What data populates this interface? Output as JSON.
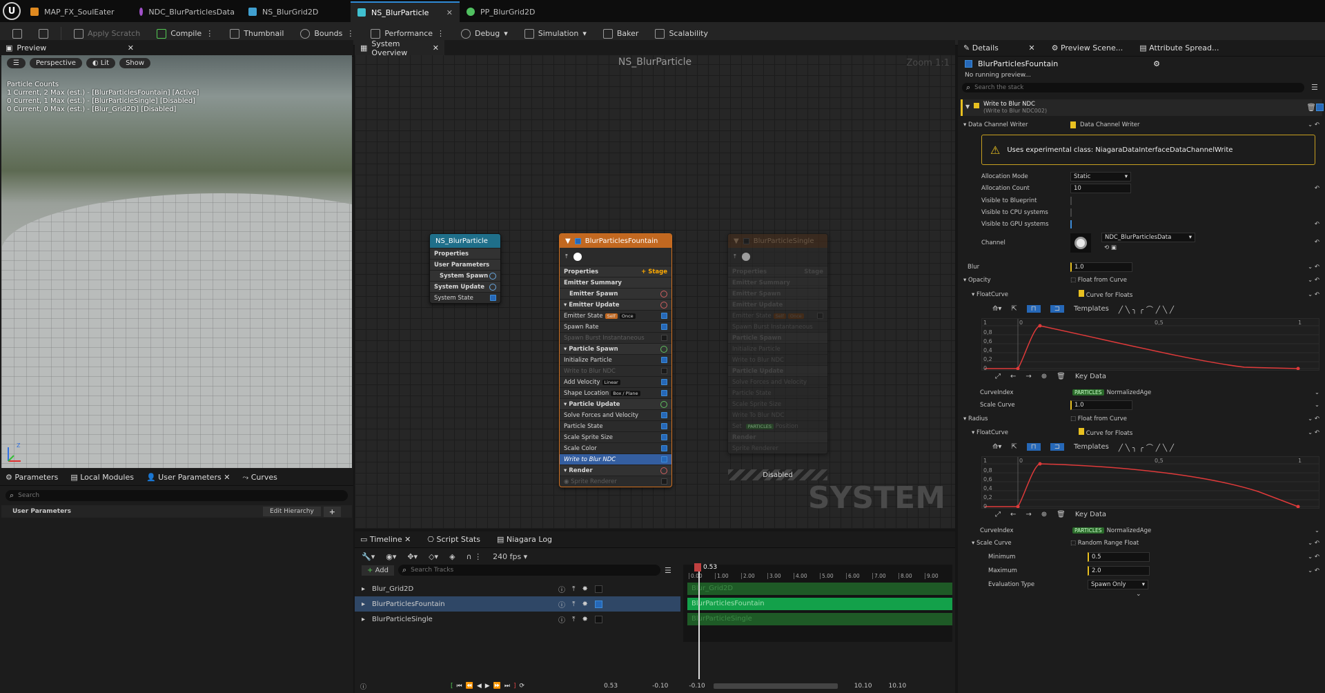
{
  "tabs": [
    {
      "label": "MAP_FX_SoulEater",
      "color": "#e08a20"
    },
    {
      "label": "NDC_BlurParticlesData",
      "color": "#a050c8"
    },
    {
      "label": "NS_BlurGrid2D",
      "color": "#40a0d0"
    },
    {
      "label": "NS_BlurParticle",
      "color": "#40c0d0",
      "active": true
    },
    {
      "label": "PP_BlurGrid2D",
      "color": "#50c060"
    }
  ],
  "toolbar": {
    "apply_scratch": "Apply Scratch",
    "compile": "Compile",
    "thumbnail": "Thumbnail",
    "bounds": "Bounds",
    "performance": "Performance",
    "debug": "Debug",
    "simulation": "Simulation",
    "baker": "Baker",
    "scalability": "Scalability"
  },
  "preview": {
    "tab": "Preview",
    "perspective": "Perspective",
    "lit": "Lit",
    "show": "Show",
    "stats_title": "Particle Counts",
    "stats": [
      "1 Current, 2 Max (est.) - [BlurParticlesFountain] [Active]",
      "0 Current, 1 Max (est.) - [BlurParticleSingle] [Disabled]",
      "0 Current, 0 Max (est.) - [Blur_Grid2D] [Disabled]"
    ]
  },
  "params": {
    "tabs": [
      "Parameters",
      "Local Modules",
      "User Parameters",
      "Curves"
    ],
    "search_placeholder": "Search",
    "section": "User Parameters",
    "edit_hierarchy": "Edit Hierarchy"
  },
  "graph": {
    "tab": "System Overview",
    "title": "NS_BlurParticle",
    "zoom": "Zoom 1:1",
    "watermark": "SYSTEM",
    "system_node": {
      "title": "NS_BlurParticle",
      "rows": [
        "Properties",
        "User Parameters",
        "System Spawn",
        "System Update",
        "System State"
      ]
    },
    "fountain": {
      "title": "BlurParticlesFountain",
      "properties": "Properties",
      "stage": "Stage",
      "emitter_summary": "Emitter Summary",
      "emitter_spawn": "Emitter Spawn",
      "emitter_update": "Emitter Update",
      "emitter_state": "Emitter State",
      "self": "Self",
      "once": "Once",
      "spawn_rate": "Spawn Rate",
      "spawn_burst": "Spawn Burst Instantaneous",
      "particle_spawn": "Particle Spawn",
      "initialize_particle": "Initialize Particle",
      "write_blur": "Write to Blur NDC",
      "add_velocity": "Add Velocity",
      "linear": "Linear",
      "shape_location": "Shape Location",
      "box_plane": "Box / Plane",
      "particle_update": "Particle Update",
      "solve_forces": "Solve Forces and Velocity",
      "particle_state": "Particle State",
      "scale_sprite": "Scale Sprite Size",
      "scale_color": "Scale Color",
      "write_blur_sel": "Write to Blur NDC",
      "render": "Render",
      "sprite_renderer": "Sprite Renderer"
    },
    "single": {
      "title": "BlurParticleSingle",
      "properties": "Properties",
      "stage": "Stage",
      "emitter_summary": "Emitter Summary",
      "emitter_spawn": "Emitter Spawn",
      "emitter_update": "Emitter Update",
      "emitter_state": "Emitter State",
      "self": "Self",
      "once": "Once",
      "spawn_burst": "Spawn Burst Instantaneous",
      "particle_spawn": "Particle Spawn",
      "initialize_particle": "Initialize Particle",
      "write_blur": "Write to Blur NDC",
      "particle_update": "Particle Update",
      "solve_forces": "Solve Forces and Velocity",
      "particle_state": "Particle State",
      "scale_sprite": "Scale Sprite Size",
      "write_blur2": "Write To Blur NDC",
      "set": "Set",
      "particles": "PARTICLES",
      "position": "Position",
      "render": "Render",
      "sprite_renderer": "Sprite Renderer",
      "disabled": "Disabled"
    }
  },
  "timeline": {
    "tabs": [
      "Timeline",
      "Script Stats",
      "Niagara Log"
    ],
    "fps": "240 fps",
    "add": "Add",
    "search_placeholder": "Search Tracks",
    "playhead": "0.53",
    "current_time": "0.53",
    "range_start": "-0.10",
    "range_start2": "-0.10",
    "range_end": "10.10",
    "range_end2": "10.10",
    "ticks": [
      "0.00",
      "1.00",
      "2.00",
      "3.00",
      "4.00",
      "5.00",
      "6.00",
      "7.00",
      "8.00",
      "9.00"
    ],
    "tracks": [
      {
        "name": "Blur_Grid2D",
        "enabled": false
      },
      {
        "name": "BlurParticlesFountain",
        "enabled": true
      },
      {
        "name": "BlurParticleSingle",
        "enabled": false
      }
    ]
  },
  "details": {
    "tabs": [
      "Details",
      "Preview Scene...",
      "Attribute Spread..."
    ],
    "emitter": "BlurParticlesFountain",
    "no_preview": "No running preview...",
    "search_placeholder": "Search the stack",
    "module_title": "Write to Blur NDC",
    "module_sub": "(Write to Blur NDC002)",
    "data_channel_writer": "Data Channel Writer",
    "dcw_value": "Data Channel Writer",
    "warning": "Uses experimental class: NiagaraDataInterfaceDataChannelWrite",
    "allocation_mode": "Allocation Mode",
    "allocation_mode_v": "Static",
    "allocation_count": "Allocation Count",
    "allocation_count_v": "10",
    "vis_bp": "Visible to Blueprint",
    "vis_cpu": "Visible to CPU systems",
    "vis_gpu": "Visible to GPU systems",
    "channel": "Channel",
    "channel_v": "NDC_BlurParticlesData",
    "blur": "Blur",
    "blur_v": "1.0",
    "opacity": "Opacity",
    "float_from_curve": "Float from Curve",
    "floatcurve": "FloatCurve",
    "curve_for_floats": "Curve for Floats",
    "templates": "Templates",
    "key_data": "Key Data",
    "curve_index": "CurveIndex",
    "particles": "PARTICLES",
    "normalized_age": "NormalizedAge",
    "scale_curve": "Scale Curve",
    "scale_curve_v": "1.0",
    "radius": "Radius",
    "random_range": "Random Range Float",
    "minimum": "Minimum",
    "minimum_v": "0.5",
    "maximum": "Maximum",
    "maximum_v": "2.0",
    "evaluation_type": "Evaluation Type",
    "evaluation_type_v": "Spawn Only",
    "y_ticks": [
      "1",
      "0,8",
      "0,6",
      "0,4",
      "0,2",
      "0"
    ],
    "x_ticks": [
      "0",
      "0,5",
      "1"
    ]
  }
}
